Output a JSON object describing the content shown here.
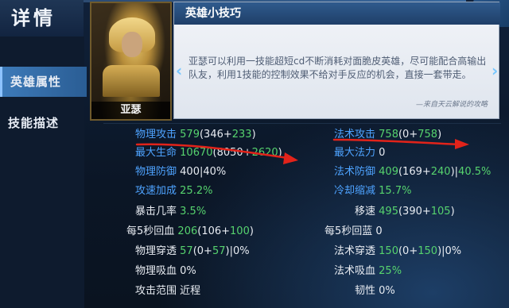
{
  "header": {
    "title": "详情",
    "close_icon": "close-icon"
  },
  "sidebar": {
    "tabs": [
      {
        "label": "英雄属性",
        "active": true
      },
      {
        "label": "技能描述",
        "active": false
      }
    ]
  },
  "hero": {
    "name": "亚瑟"
  },
  "tips": {
    "title": "英雄小技巧",
    "body": "亚瑟可以利用一技能超短cd不断消耗对面脆皮英雄，尽可能配合高输出队友，利用1技能的控制效果不给对手反应的机会，直接一套带走。",
    "source": "—来自天云解说的攻略"
  },
  "stats": {
    "phys_attack": {
      "label": "物理攻击",
      "value": "579",
      "p1": "(346+",
      "p2": "233",
      "p3": ")"
    },
    "max_hp": {
      "label": "最大生命",
      "value": "10670",
      "p1": "(8050+",
      "p2": "2620",
      "p3": ")"
    },
    "phys_def": {
      "label": "物理防御",
      "value": "400|40%"
    },
    "attack_speed": {
      "label": "攻速加成",
      "value": "25.2%"
    },
    "crit_rate": {
      "label": "暴击几率",
      "value": "3.5%"
    },
    "hp_regen": {
      "label": "每5秒回血",
      "value": "206",
      "p1": "(106+",
      "p2": "100",
      "p3": ")"
    },
    "phys_pen": {
      "label": "物理穿透",
      "value": "57",
      "p1": "(0+",
      "p2": "57",
      "p3": ")|0%"
    },
    "phys_vamp": {
      "label": "物理吸血",
      "value": "0%"
    },
    "attack_range": {
      "label": "攻击范围",
      "value": "近程"
    },
    "magic_attack": {
      "label": "法术攻击",
      "value": "758",
      "p1": "(0+",
      "p2": "758",
      "p3": ")"
    },
    "max_mana": {
      "label": "最大法力",
      "value": "0"
    },
    "magic_def": {
      "label": "法术防御",
      "value": "409",
      "p1": "(169+",
      "p2": "240",
      "p3": ")|",
      "p4": "40.5%"
    },
    "cdr": {
      "label": "冷却缩减",
      "value": "15.7%"
    },
    "move_speed": {
      "label": "移速",
      "value": "495",
      "p1": "(390+",
      "p2": "105",
      "p3": ")"
    },
    "mana_regen": {
      "label": "每5秒回蓝",
      "value": "0"
    },
    "magic_pen": {
      "label": "法术穿透",
      "value": "150",
      "p1": "(0+",
      "p2": "150",
      "p3": ")|0%"
    },
    "magic_vamp": {
      "label": "法术吸血",
      "value": "25%"
    },
    "tenacity": {
      "label": "韧性",
      "value": "0%"
    }
  },
  "colors": {
    "accent_blue": "#4ea3ff",
    "value_green": "#56d36e",
    "arrow_red": "#e2231a"
  }
}
